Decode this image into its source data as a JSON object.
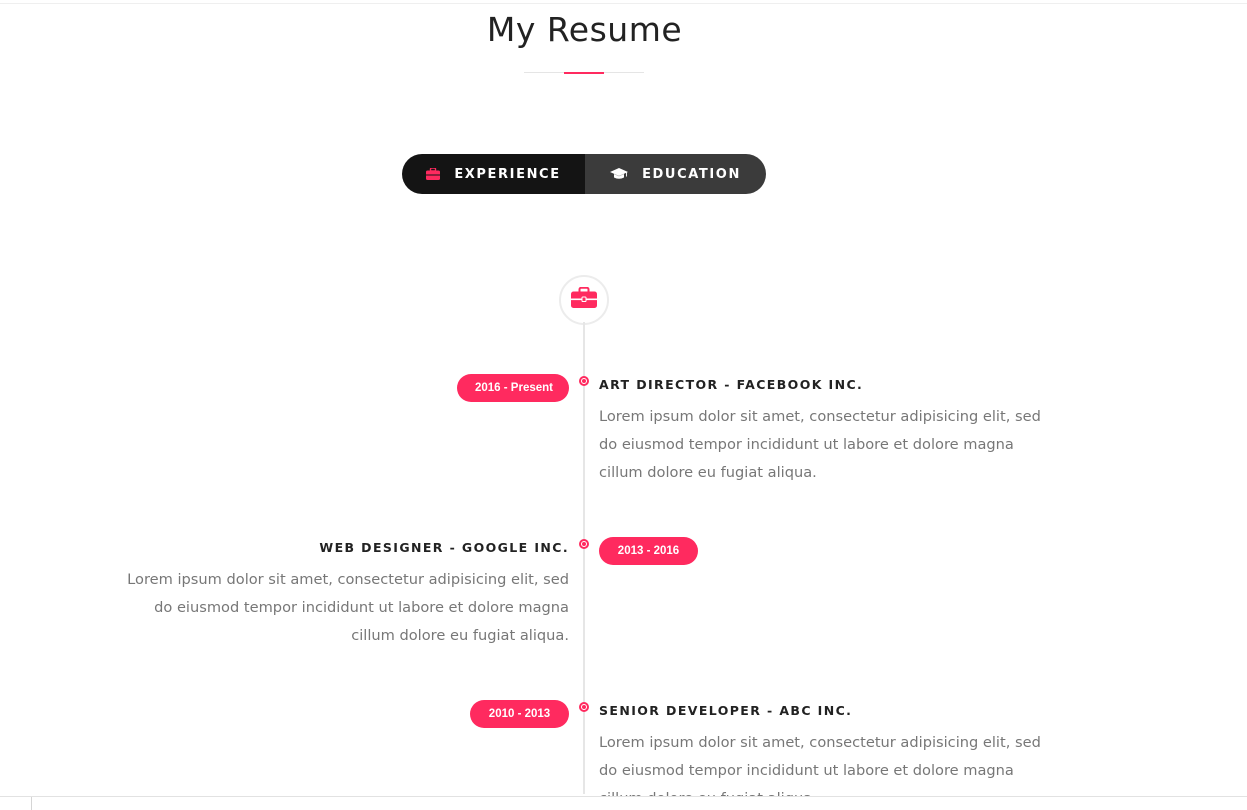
{
  "section": {
    "title": "My Resume"
  },
  "tabs": [
    {
      "label": "EXPERIENCE",
      "icon": "briefcase-icon",
      "active": true
    },
    {
      "label": "EDUCATION",
      "icon": "graduation-cap-icon",
      "active": false
    }
  ],
  "timeline": {
    "header_icon": "briefcase-icon",
    "entries": [
      {
        "period": "2016 - Present",
        "title": "ART DIRECTOR - FACEBOOK INC.",
        "description": "Lorem ipsum dolor sit amet, consectetur adipisicing elit, sed do eiusmod tempor incididunt ut labore et dolore magna cillum dolore eu fugiat aliqua."
      },
      {
        "period": "2013 - 2016",
        "title": "WEB DESIGNER - GOOGLE INC.",
        "description": "Lorem ipsum dolor sit amet, consectetur adipisicing elit, sed do eiusmod tempor incididunt ut labore et dolore magna cillum dolore eu fugiat aliqua."
      },
      {
        "period": "2010 - 2013",
        "title": "SENIOR DEVELOPER - ABC INC.",
        "description": "Lorem ipsum dolor sit amet, consectetur adipisicing elit, sed do eiusmod tempor incididunt ut labore et dolore magna cillum dolore eu fugiat aliqua."
      }
    ]
  },
  "colors": {
    "accent": "#ff2a5f",
    "tab_active_bg": "#141414",
    "tab_inactive_bg": "#3b3b3b",
    "text_dark": "#222222",
    "text_muted": "#777777"
  }
}
